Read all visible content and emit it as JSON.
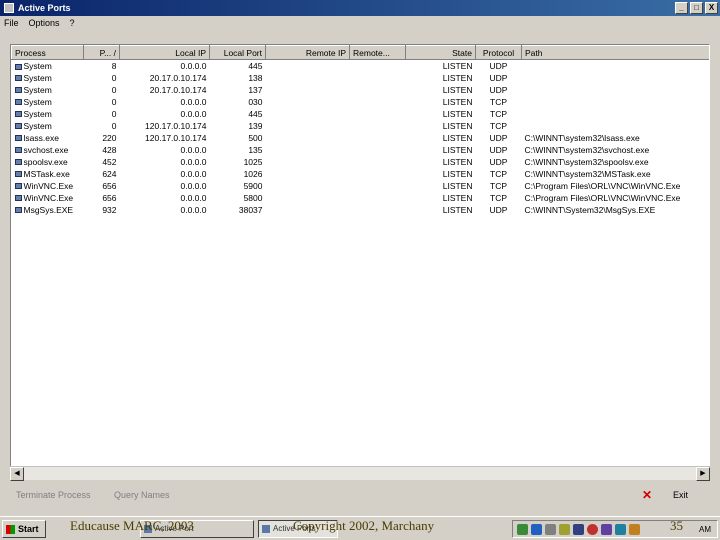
{
  "window": {
    "title": "Active Ports",
    "buttons": [
      "_",
      "□",
      "X"
    ]
  },
  "menu": [
    "File",
    "Options",
    "?"
  ],
  "columns": [
    "Process",
    "P... /",
    "Local IP",
    "Local Port",
    "Remote IP",
    "Remote...",
    "State",
    "Protocol",
    "Path"
  ],
  "rows": [
    [
      "System",
      "8",
      "0.0.0.0",
      "445",
      "",
      "",
      "LISTEN",
      "UDP",
      ""
    ],
    [
      "System",
      "0",
      "20.17.0.10.174",
      "138",
      "",
      "",
      "LISTEN",
      "UDP",
      ""
    ],
    [
      "System",
      "0",
      "20.17.0.10.174",
      "137",
      "",
      "",
      "LISTEN",
      "UDP",
      ""
    ],
    [
      "System",
      "0",
      "0.0.0.0",
      "030",
      "",
      "",
      "LISTEN",
      "TCP",
      ""
    ],
    [
      "System",
      "0",
      "0.0.0.0",
      "445",
      "",
      "",
      "LISTEN",
      "TCP",
      ""
    ],
    [
      "System",
      "0",
      "120.17.0.10.174",
      "139",
      "",
      "",
      "LISTEN",
      "TCP",
      ""
    ],
    [
      "lsass.exe",
      "220",
      "120.17.0.10.174",
      "500",
      "",
      "",
      "LISTEN",
      "UDP",
      "C:\\WINNT\\system32\\lsass.exe"
    ],
    [
      "svchost.exe",
      "428",
      "0.0.0.0",
      "135",
      "",
      "",
      "LISTEN",
      "UDP",
      "C:\\WINNT\\system32\\svchost.exe"
    ],
    [
      "spoolsv.exe",
      "452",
      "0.0.0.0",
      "1025",
      "",
      "",
      "LISTEN",
      "UDP",
      "C:\\WINNT\\system32\\spoolsv.exe"
    ],
    [
      "MSTask.exe",
      "624",
      "0.0.0.0",
      "1026",
      "",
      "",
      "LISTEN",
      "TCP",
      "C:\\WINNT\\system32\\MSTask.exe"
    ],
    [
      "WinVNC.Exe",
      "656",
      "0.0.0.0",
      "5900",
      "",
      "",
      "LISTEN",
      "TCP",
      "C:\\Program Files\\ORL\\VNC\\WinVNC.Exe"
    ],
    [
      "WinVNC.Exe",
      "656",
      "0.0.0.0",
      "5800",
      "",
      "",
      "LISTEN",
      "TCP",
      "C:\\Program Files\\ORL\\VNC\\WinVNC.Exe"
    ],
    [
      "MsgSys.EXE",
      "932",
      "0.0.0.0",
      "38037",
      "",
      "",
      "LISTEN",
      "UDP",
      "C:\\WINNT\\System32\\MsgSys.EXE"
    ]
  ],
  "actions": {
    "terminate": "Terminate Process",
    "query": "Query Names",
    "exit": "Exit"
  },
  "taskbar": {
    "start": "Start",
    "task1": "Active Port",
    "task2": "Active Ports",
    "clock": "AM"
  },
  "slide": {
    "left": "Educause MARC, 2003",
    "center": "Copyright 2002, Marchany",
    "page": "35"
  }
}
